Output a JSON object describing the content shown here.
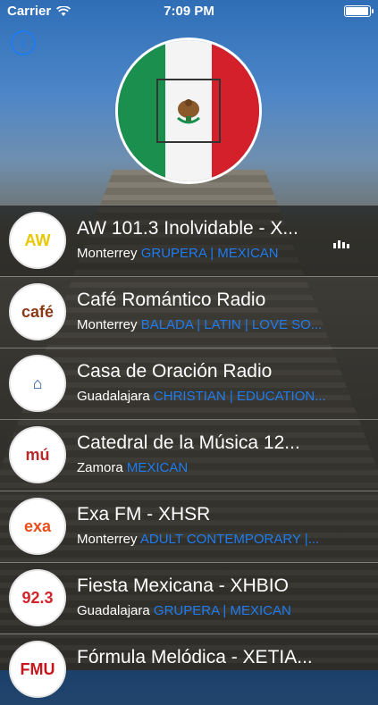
{
  "status_bar": {
    "carrier": "Carrier",
    "time": "7:09 PM",
    "battery_level": 1.0
  },
  "header": {
    "info_icon": "info-icon",
    "flag": "mexico-flag"
  },
  "stations": [
    {
      "name": "AW 101.3 Inolvidable - X...",
      "city": "Monterrey",
      "genres": "GRUPERA | MEXICAN",
      "logo_text": "AW",
      "logo_color": "#e7c800",
      "playing": true
    },
    {
      "name": "Café Romántico Radio",
      "city": "Monterrey",
      "genres": "BALADA | LATIN | LOVE SO...",
      "logo_text": "café",
      "logo_color": "#8a3a16",
      "playing": false
    },
    {
      "name": "Casa de Oración Radio",
      "city": "Guadalajara",
      "genres": "CHRISTIAN | EDUCATION...",
      "logo_text": "⌂",
      "logo_color": "#1b4e9c",
      "playing": false
    },
    {
      "name": "Catedral de la Música 12...",
      "city": "Zamora",
      "genres": "MEXICAN",
      "logo_text": "mú",
      "logo_color": "#b52a2a",
      "playing": false
    },
    {
      "name": "Exa FM - XHSR",
      "city": "Monterrey",
      "genres": "ADULT CONTEMPORARY |...",
      "logo_text": "exa",
      "logo_color": "#e84e1b",
      "playing": false
    },
    {
      "name": "Fiesta Mexicana - XHBIO",
      "city": "Guadalajara",
      "genres": "GRUPERA | MEXICAN",
      "logo_text": "92.3",
      "logo_color": "#d1252e",
      "playing": false
    },
    {
      "name": "Fórmula Melódica - XETIA...",
      "city": "",
      "genres": "",
      "logo_text": "FMU",
      "logo_color": "#c4161c",
      "playing": false
    }
  ]
}
